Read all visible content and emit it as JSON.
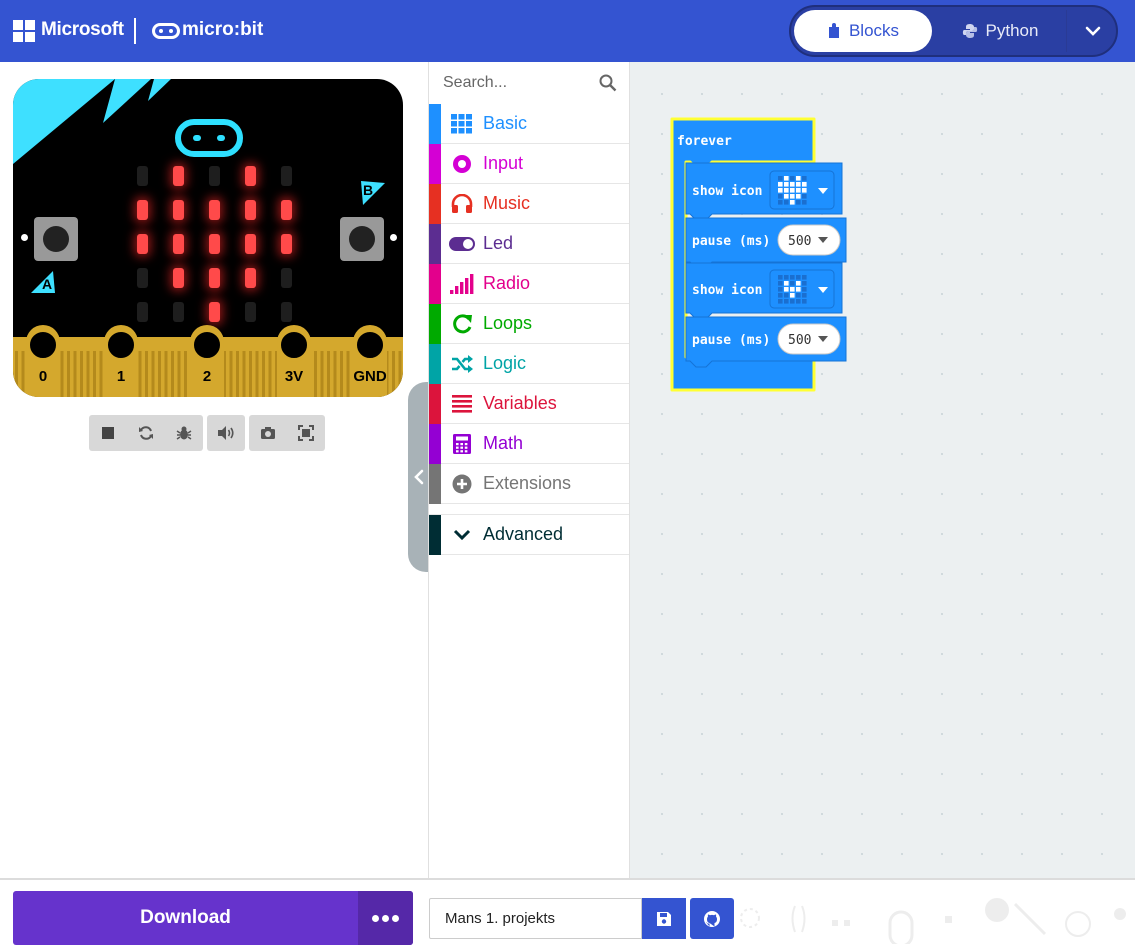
{
  "header": {
    "brand": "Microsoft",
    "product": "micro:bit",
    "modes": {
      "blocks": "Blocks",
      "python": "Python"
    }
  },
  "simulator": {
    "led_matrix": [
      [
        0,
        1,
        0,
        1,
        0
      ],
      [
        1,
        1,
        1,
        1,
        1
      ],
      [
        1,
        1,
        1,
        1,
        1
      ],
      [
        0,
        1,
        1,
        1,
        0
      ],
      [
        0,
        0,
        1,
        0,
        0
      ]
    ],
    "button_a": "A",
    "button_b": "B",
    "pins": [
      "0",
      "1",
      "2",
      "3V",
      "GND"
    ]
  },
  "toolbox": {
    "search_placeholder": "Search...",
    "categories": [
      {
        "label": "Basic",
        "color": "#1e90ff",
        "icon": "grid-icon"
      },
      {
        "label": "Input",
        "color": "#d400d4",
        "icon": "target-icon"
      },
      {
        "label": "Music",
        "color": "#e63022",
        "icon": "headphones-icon"
      },
      {
        "label": "Led",
        "color": "#5c2d91",
        "icon": "toggle-icon"
      },
      {
        "label": "Radio",
        "color": "#e3008c",
        "icon": "signal-bars-icon"
      },
      {
        "label": "Loops",
        "color": "#00aa00",
        "icon": "loop-arrow-icon"
      },
      {
        "label": "Logic",
        "color": "#00a4a6",
        "icon": "shuffle-icon"
      },
      {
        "label": "Variables",
        "color": "#dc143c",
        "icon": "list-lines-icon"
      },
      {
        "label": "Math",
        "color": "#9400d3",
        "icon": "calculator-icon"
      },
      {
        "label": "Extensions",
        "color": "#757575",
        "icon": "plus-circle-icon"
      }
    ],
    "advanced": {
      "label": "Advanced",
      "color": "#002d34"
    }
  },
  "workspace": {
    "forever": "forever",
    "show_icon": "show icon",
    "pause": "pause (ms)",
    "pause_value_1": "500",
    "pause_value_2": "500",
    "icon_big_heart": [
      [
        0,
        1,
        0,
        1,
        0
      ],
      [
        1,
        1,
        1,
        1,
        1
      ],
      [
        1,
        1,
        1,
        1,
        1
      ],
      [
        0,
        1,
        1,
        1,
        0
      ],
      [
        0,
        0,
        1,
        0,
        0
      ]
    ],
    "icon_small_heart": [
      [
        0,
        0,
        0,
        0,
        0
      ],
      [
        0,
        1,
        0,
        1,
        0
      ],
      [
        0,
        1,
        1,
        1,
        0
      ],
      [
        0,
        0,
        1,
        0,
        0
      ],
      [
        0,
        0,
        0,
        0,
        0
      ]
    ]
  },
  "footer": {
    "download_label": "Download",
    "project_name": "Mans 1. projekts"
  }
}
